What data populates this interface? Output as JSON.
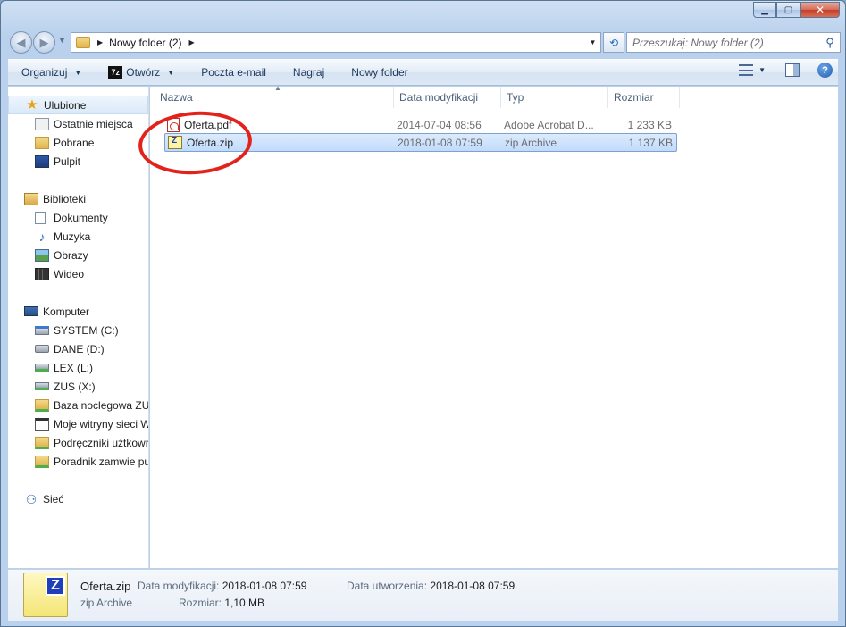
{
  "breadcrumb": {
    "folder": "Nowy folder (2)"
  },
  "search": {
    "placeholder": "Przeszukaj: Nowy folder (2)"
  },
  "toolbar": {
    "organize": "Organizuj",
    "open_7z_icon": "7z",
    "open": "Otwórz",
    "email": "Poczta e-mail",
    "burn": "Nagraj",
    "new_folder": "Nowy folder"
  },
  "sidebar": {
    "favorites": {
      "label": "Ulubione",
      "items": [
        "Ostatnie miejsca",
        "Pobrane",
        "Pulpit"
      ]
    },
    "libraries": {
      "label": "Biblioteki",
      "items": [
        "Dokumenty",
        "Muzyka",
        "Obrazy",
        "Wideo"
      ]
    },
    "computer": {
      "label": "Komputer",
      "items": [
        "SYSTEM (C:)",
        "DANE (D:)",
        "LEX (L:)",
        "ZUS (X:)",
        "Baza noclegowa ZUS",
        "Moje witryny sieci W",
        "Podręczniki użtkowr",
        "Poradnik zamwie pu"
      ]
    },
    "network": {
      "label": "Sieć"
    }
  },
  "columns": {
    "name": "Nazwa",
    "date": "Data modyfikacji",
    "type": "Typ",
    "size": "Rozmiar"
  },
  "files": [
    {
      "name": "Oferta.pdf",
      "date": "2014-07-04 08:56",
      "type": "Adobe Acrobat D...",
      "size": "1 233 KB"
    },
    {
      "name": "Oferta.zip",
      "date": "2018-01-08 07:59",
      "type": "zip Archive",
      "size": "1 137 KB"
    }
  ],
  "details": {
    "file_name": "Oferta.zip",
    "file_type": "zip Archive",
    "modified_label": "Data modyfikacji:",
    "modified_value": "2018-01-08 07:59",
    "size_label": "Rozmiar:",
    "size_value": "1,10 MB",
    "created_label": "Data utworzenia:",
    "created_value": "2018-01-08 07:59",
    "badge_letter": "Z"
  },
  "icons": {
    "back": "arrow-left-icon",
    "forward": "arrow-right-icon",
    "refresh": "refresh-icon",
    "search": "magnifier-icon",
    "help": "help-icon",
    "highlight": "red-ellipse"
  }
}
